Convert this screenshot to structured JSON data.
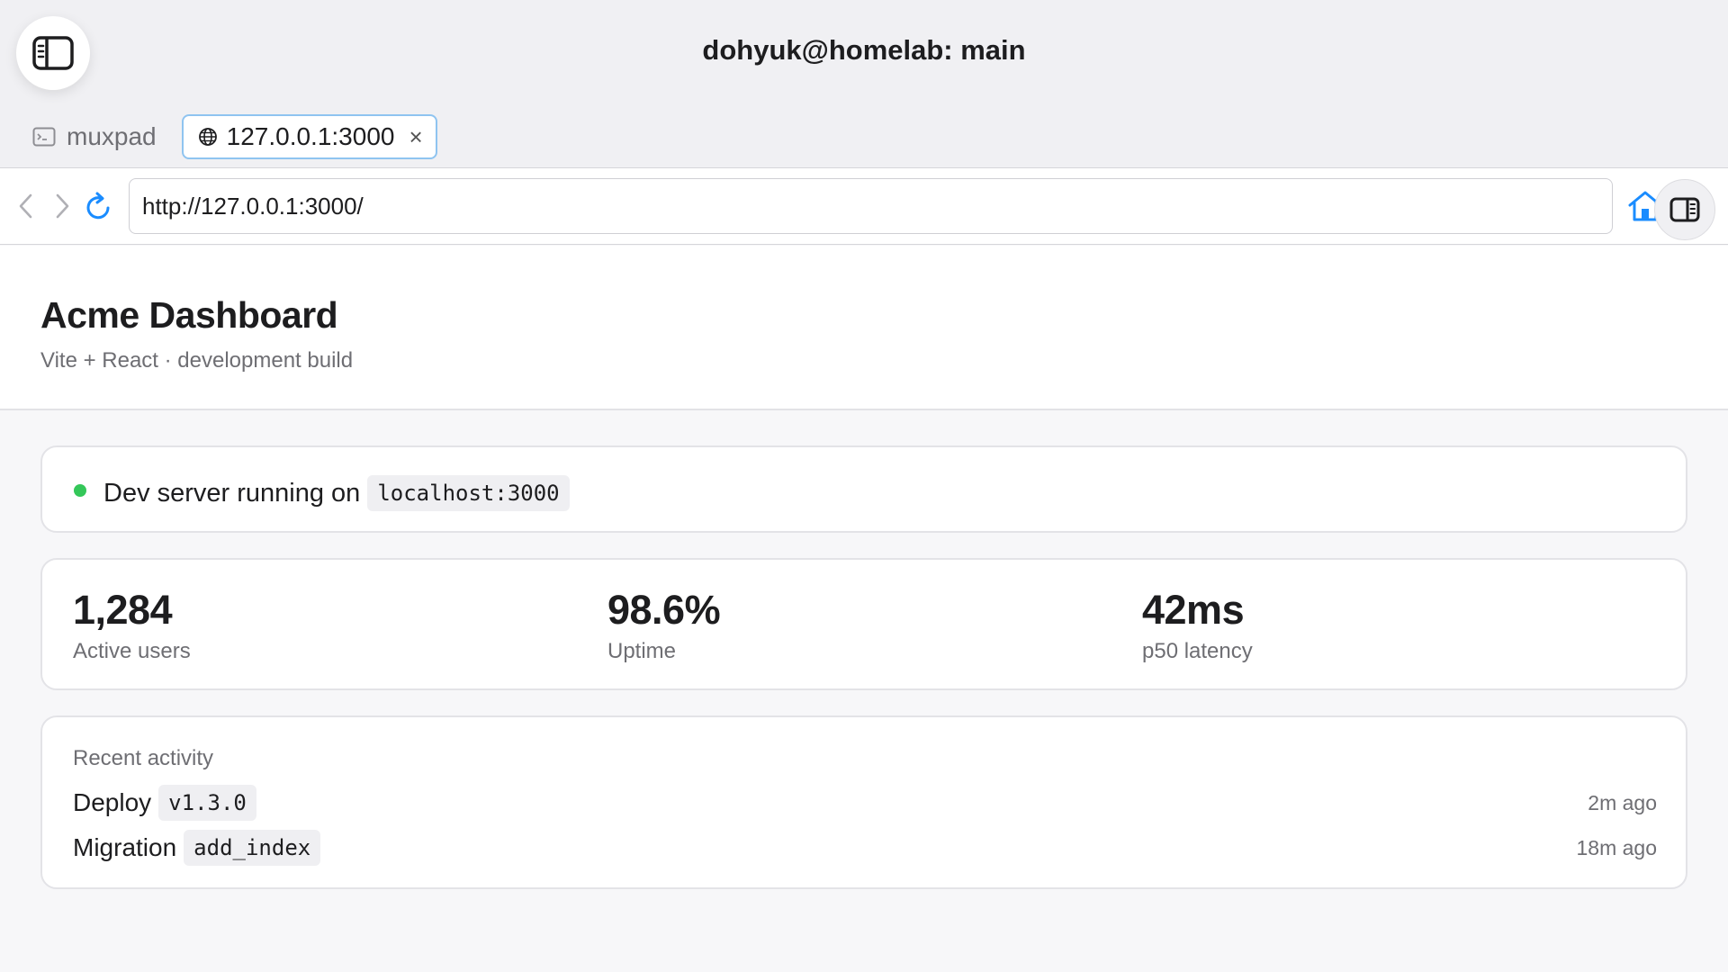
{
  "window": {
    "title": "dohyuk@homelab: main"
  },
  "tabs": [
    {
      "label": "muxpad",
      "icon": "terminal-icon",
      "active": false
    },
    {
      "label": "127.0.0.1:3000",
      "icon": "globe-icon",
      "active": true,
      "close_glyph": "×"
    }
  ],
  "navbar": {
    "url": "http://127.0.0.1:3000/",
    "accent_color": "#1a8cff"
  },
  "page": {
    "title": "Acme Dashboard",
    "subtitle": "Vite + React · development build"
  },
  "status": {
    "text": "Dev server running on",
    "host": "localhost:3000",
    "dot_color": "#34c759"
  },
  "stats": [
    {
      "value": "1,284",
      "label": "Active users"
    },
    {
      "value": "98.6%",
      "label": "Uptime"
    },
    {
      "value": "42ms",
      "label": "p50 latency"
    }
  ],
  "activity": {
    "heading": "Recent activity",
    "items": [
      {
        "label": "Deploy",
        "code": "v1.3.0",
        "time": "2m ago"
      },
      {
        "label": "Migration",
        "code": "add_index",
        "time": "18m ago"
      }
    ]
  }
}
